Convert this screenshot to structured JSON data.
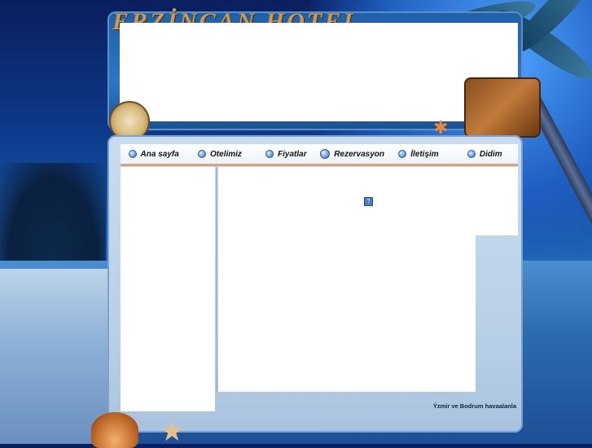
{
  "header": {
    "brand_text": "ERZİNCAN HOTEL"
  },
  "nav": {
    "items": [
      {
        "label": "Ana sayfa",
        "icon": "bullet-icon"
      },
      {
        "label": "Otelimiz",
        "icon": "bullet-icon"
      },
      {
        "label": "Fiyatlar",
        "icon": "bullet-icon"
      },
      {
        "label": "Rezervasyon",
        "icon": "bullet-icon"
      },
      {
        "label": "İletişim",
        "icon": "bullet-icon"
      },
      {
        "label": "Didim",
        "icon": "bullet-icon"
      }
    ]
  },
  "content": {
    "broken_image_glyph": "?"
  },
  "footer": {
    "text": "Ýzmir ve Bodrum havaalanla"
  },
  "colors": {
    "nav_underline": "#d9a27a",
    "frame_blue": "#1f5fa8",
    "brand_gold": "#c89a55"
  }
}
